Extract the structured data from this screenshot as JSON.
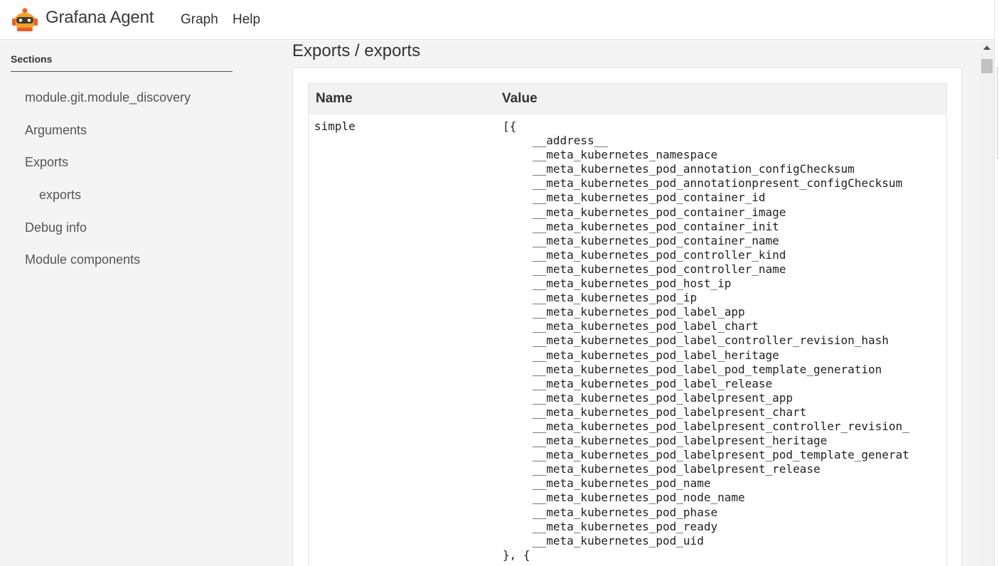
{
  "header": {
    "brand": "Grafana Agent",
    "logo_icon": "grafana-agent-logo",
    "nav": [
      "Graph",
      "Help"
    ]
  },
  "sidebar": {
    "title": "Sections",
    "items": [
      {
        "label": "module.git.module_discovery"
      },
      {
        "label": "Arguments"
      },
      {
        "label": "Exports"
      },
      {
        "label": "exports"
      },
      {
        "label": "Debug info"
      },
      {
        "label": "Module components"
      }
    ]
  },
  "main": {
    "title": "Exports / exports",
    "table": {
      "headers": [
        "Name",
        "Value"
      ],
      "row": {
        "name": "simple",
        "value_lines": [
          "[{",
          "__address__",
          "__meta_kubernetes_namespace",
          "__meta_kubernetes_pod_annotation_configChecksum",
          "__meta_kubernetes_pod_annotationpresent_configChecksum",
          "__meta_kubernetes_pod_container_id",
          "__meta_kubernetes_pod_container_image",
          "__meta_kubernetes_pod_container_init",
          "__meta_kubernetes_pod_container_name",
          "__meta_kubernetes_pod_controller_kind",
          "__meta_kubernetes_pod_controller_name",
          "__meta_kubernetes_pod_host_ip",
          "__meta_kubernetes_pod_ip",
          "__meta_kubernetes_pod_label_app",
          "__meta_kubernetes_pod_label_chart",
          "__meta_kubernetes_pod_label_controller_revision_hash",
          "__meta_kubernetes_pod_label_heritage",
          "__meta_kubernetes_pod_label_pod_template_generation",
          "__meta_kubernetes_pod_label_release",
          "__meta_kubernetes_pod_labelpresent_app",
          "__meta_kubernetes_pod_labelpresent_chart",
          "__meta_kubernetes_pod_labelpresent_controller_revision_",
          "__meta_kubernetes_pod_labelpresent_heritage",
          "__meta_kubernetes_pod_labelpresent_pod_template_generat",
          "__meta_kubernetes_pod_labelpresent_release",
          "__meta_kubernetes_pod_name",
          "__meta_kubernetes_pod_node_name",
          "__meta_kubernetes_pod_phase",
          "__meta_kubernetes_pod_ready",
          "__meta_kubernetes_pod_uid",
          "}, {"
        ]
      }
    }
  }
}
